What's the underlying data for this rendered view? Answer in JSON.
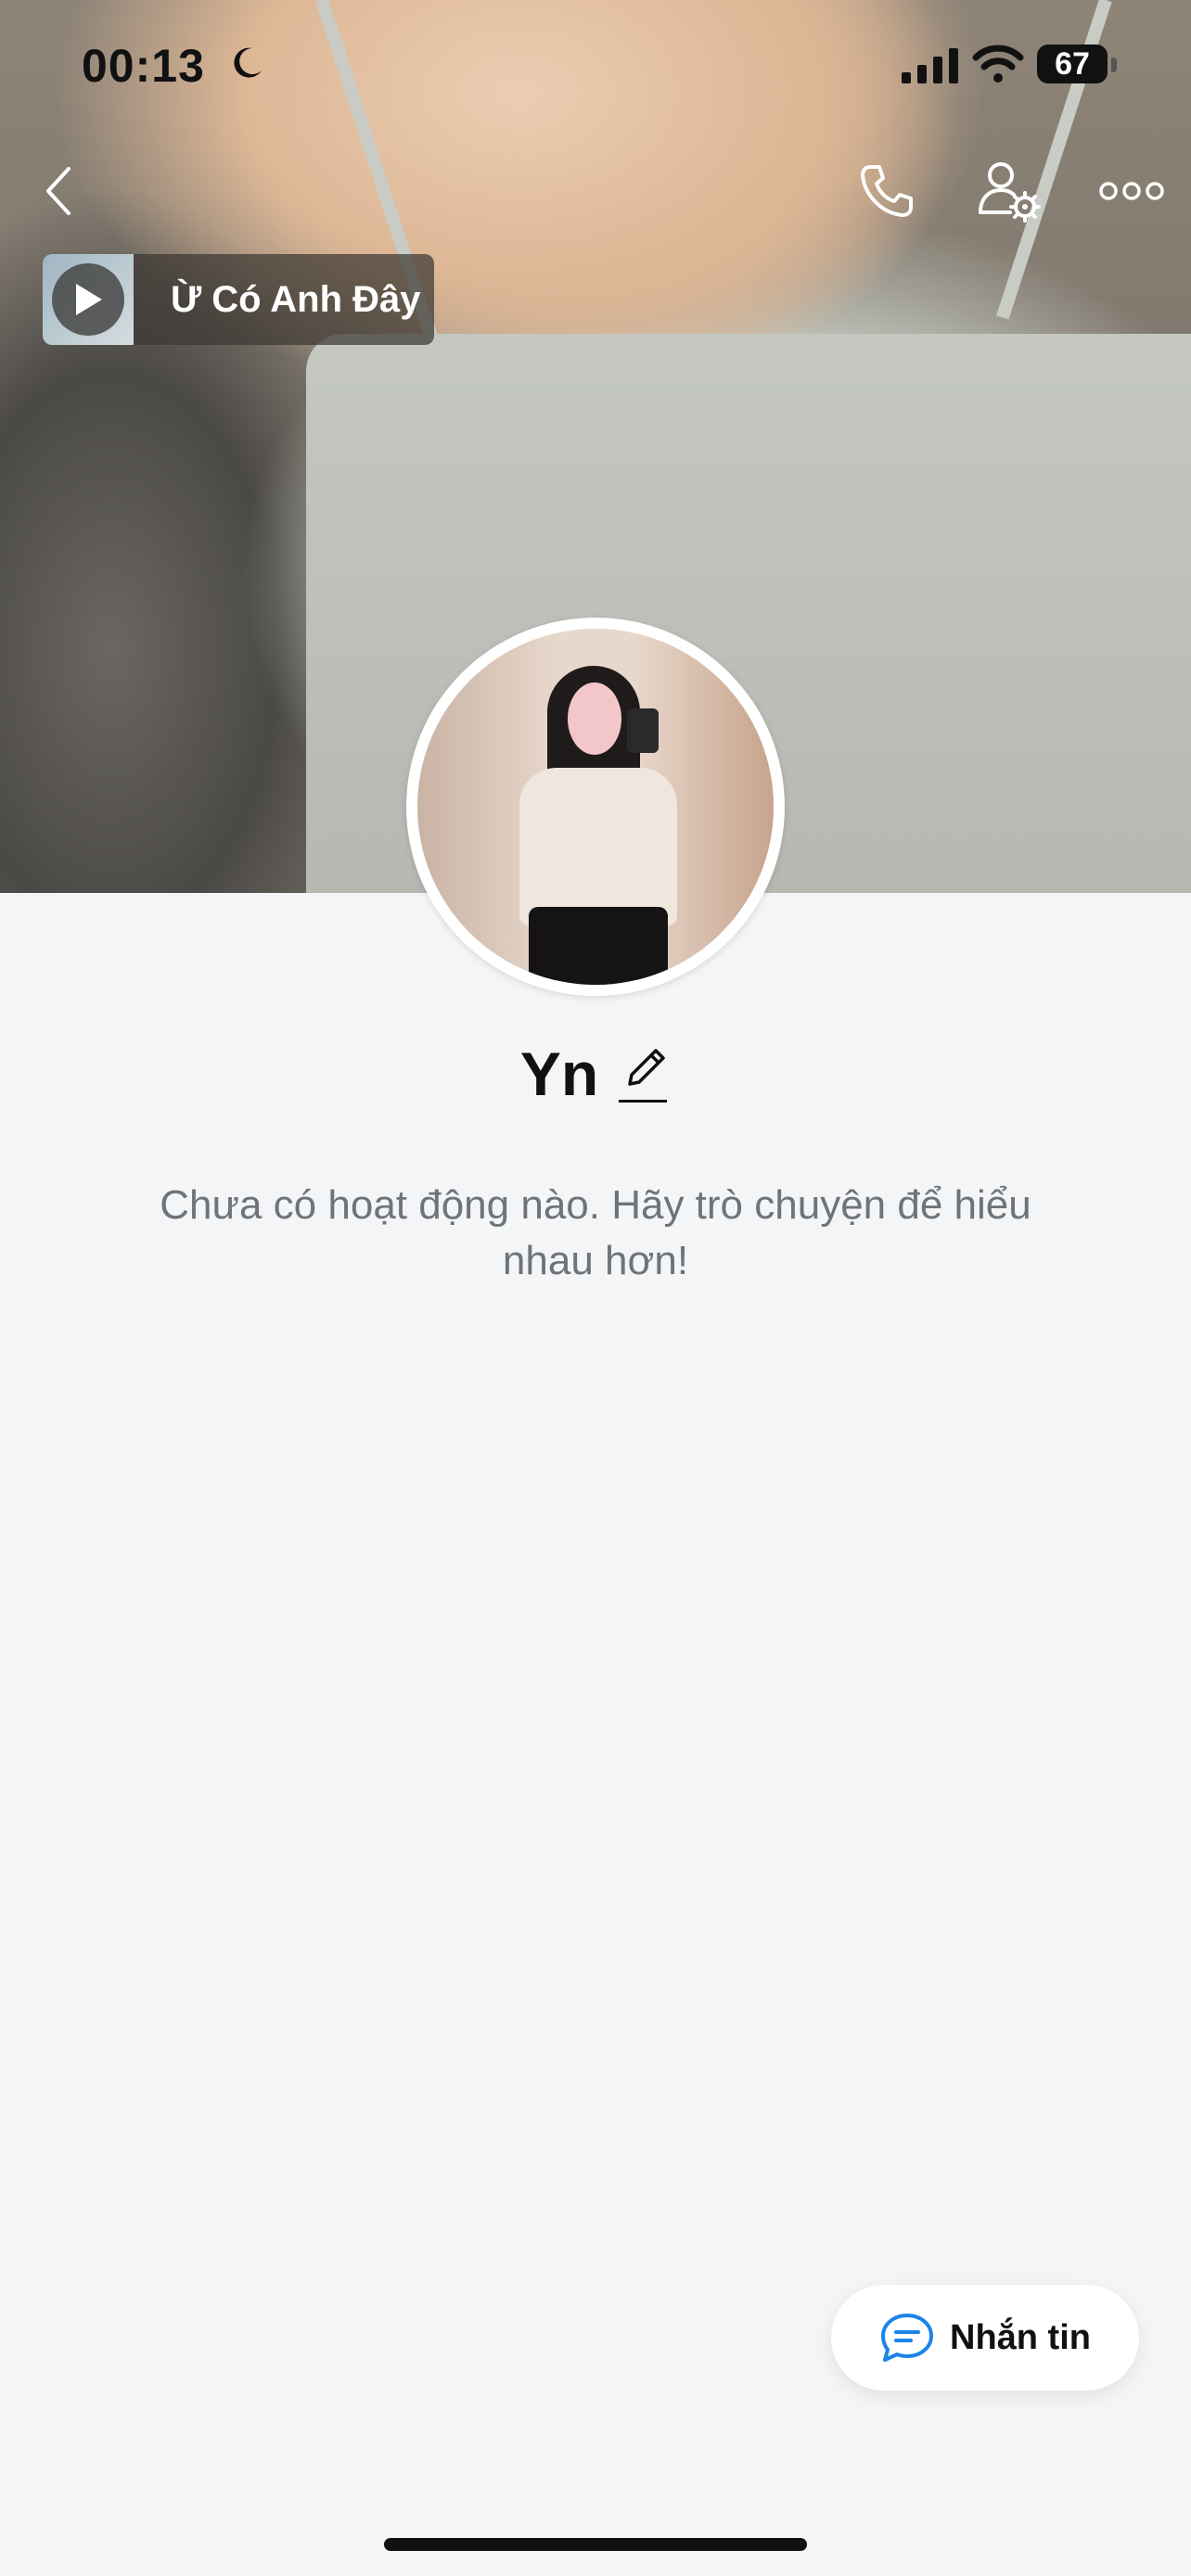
{
  "status_bar": {
    "time": "00:13",
    "battery": "67",
    "icons": [
      "moon-icon",
      "signal-icon",
      "wifi-icon",
      "battery-icon"
    ]
  },
  "nav": {
    "icons": [
      "back-chevron-icon",
      "phone-call-icon",
      "profile-settings-icon",
      "more-dots-icon"
    ]
  },
  "music": {
    "song_title": "Ừ Có Anh Đây",
    "icon": "play-icon"
  },
  "profile": {
    "name": "Yn",
    "edit_icon": "pencil-edit-icon",
    "empty_message": "Chưa có hoạt động nào. Hãy trò chuyện để hiểu nhau hơn!"
  },
  "actions": {
    "message_label": "Nhắn tin",
    "message_icon": "chat-bubble-icon",
    "accent_color": "#1b84e8"
  }
}
